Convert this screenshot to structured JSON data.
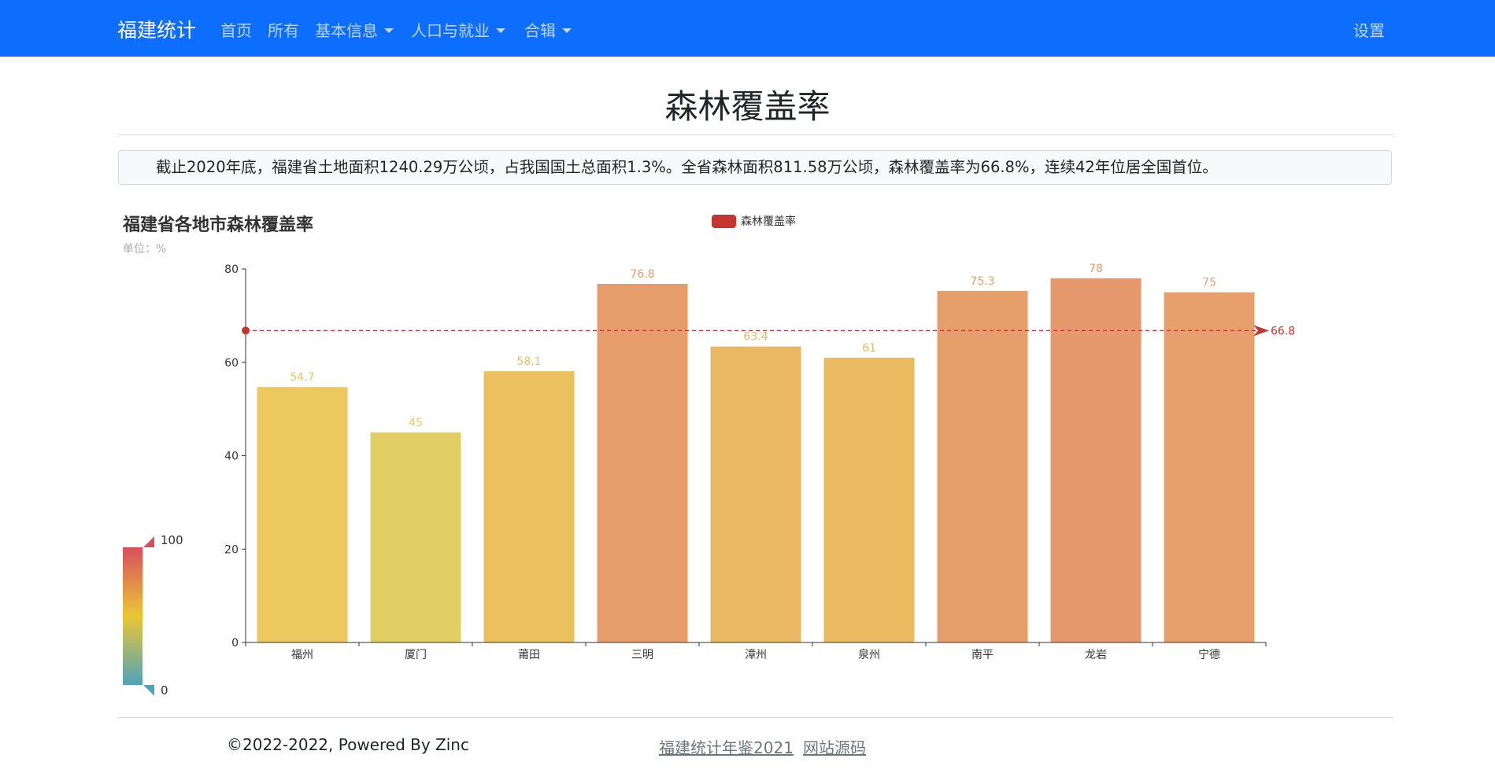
{
  "navbar": {
    "brand": "福建统计",
    "items": [
      {
        "label": "首页"
      },
      {
        "label": "所有"
      },
      {
        "label": "基本信息",
        "icon": "caret-down-icon"
      },
      {
        "label": "人口与就业",
        "icon": "caret-down-icon"
      },
      {
        "label": "合辑",
        "icon": "caret-down-icon"
      }
    ],
    "settings": "设置",
    "bg_color": "#0d6efd"
  },
  "page": {
    "title": "森林覆盖率",
    "summary": "截止2020年底，福建省土地面积1240.29万公顷，占我国国土总面积1.3%。全省森林面积811.58万公顷，森林覆盖率为66.8%，连续42年位居全国首位。"
  },
  "chart_data": {
    "type": "bar",
    "title": "福建省各地市森林覆盖率",
    "subtitle": "单位：%",
    "legend": {
      "label": "森林覆盖率",
      "position": "top-center",
      "color": "#c23531"
    },
    "categories": [
      "福州",
      "厦门",
      "莆田",
      "三明",
      "漳州",
      "泉州",
      "南平",
      "龙岩",
      "宁德"
    ],
    "series": [
      {
        "name": "森林覆盖率",
        "values": [
          54.7,
          45,
          58.1,
          76.8,
          63.4,
          61,
          75.3,
          78,
          75
        ]
      }
    ],
    "ylim": [
      0,
      80
    ],
    "yticks": [
      0,
      20,
      40,
      60,
      80
    ],
    "average_line": {
      "value": 66.8,
      "label": "66.8",
      "color": "#c23531"
    },
    "visual_map": {
      "min": 0,
      "max": 100,
      "min_label": "0",
      "max_label": "100",
      "colors": [
        "#50a3ba",
        "#eac736",
        "#d94e5d"
      ]
    },
    "grid": false
  },
  "footer": {
    "copyright": "©2022-2022, Powered By Zinc",
    "links": [
      "福建统计年鉴2021",
      "网站源码"
    ]
  }
}
